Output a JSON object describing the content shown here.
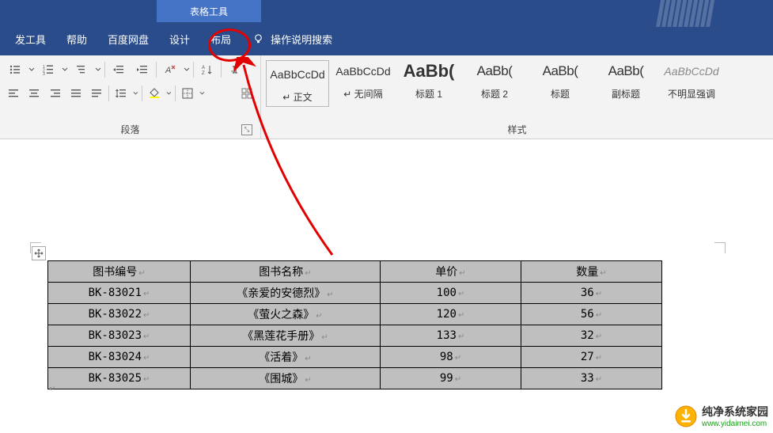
{
  "contextTab": "表格工具",
  "tabs": {
    "dev": "发工具",
    "help": "帮助",
    "baidu": "百度网盘",
    "design": "设计",
    "layout": "布局",
    "tellme": "操作说明搜索"
  },
  "ribbon": {
    "paragraph_label": "段落",
    "styles_label": "样式",
    "styles": [
      {
        "preview": "AaBbCcDd",
        "name": "↵ 正文",
        "cls": ""
      },
      {
        "preview": "AaBbCcDd",
        "name": "↵ 无间隔",
        "cls": ""
      },
      {
        "preview": "AaBb(",
        "name": "标题 1",
        "cls": "big"
      },
      {
        "preview": "AaBb(",
        "name": "标题 2",
        "cls": "med"
      },
      {
        "preview": "AaBb(",
        "name": "标题",
        "cls": "med"
      },
      {
        "preview": "AaBb(",
        "name": "副标题",
        "cls": "med"
      },
      {
        "preview": "AaBbCcDd",
        "name": "不明显强调",
        "cls": "ital"
      }
    ]
  },
  "table": {
    "headers": [
      "图书编号",
      "图书名称",
      "单价",
      "数量"
    ],
    "rows": [
      [
        "BK-83021",
        "《亲爱的安德烈》",
        "100",
        "36"
      ],
      [
        "BK-83022",
        "《萤火之森》",
        "120",
        "56"
      ],
      [
        "BK-83023",
        "《黑莲花手册》",
        "133",
        "32"
      ],
      [
        "BK-83024",
        "《活着》",
        "98",
        "27"
      ],
      [
        "BK-83025",
        "《围城》",
        "99",
        "33"
      ]
    ]
  },
  "watermark": {
    "title": "纯净系统家园",
    "url": "www.yidaimei.com"
  }
}
